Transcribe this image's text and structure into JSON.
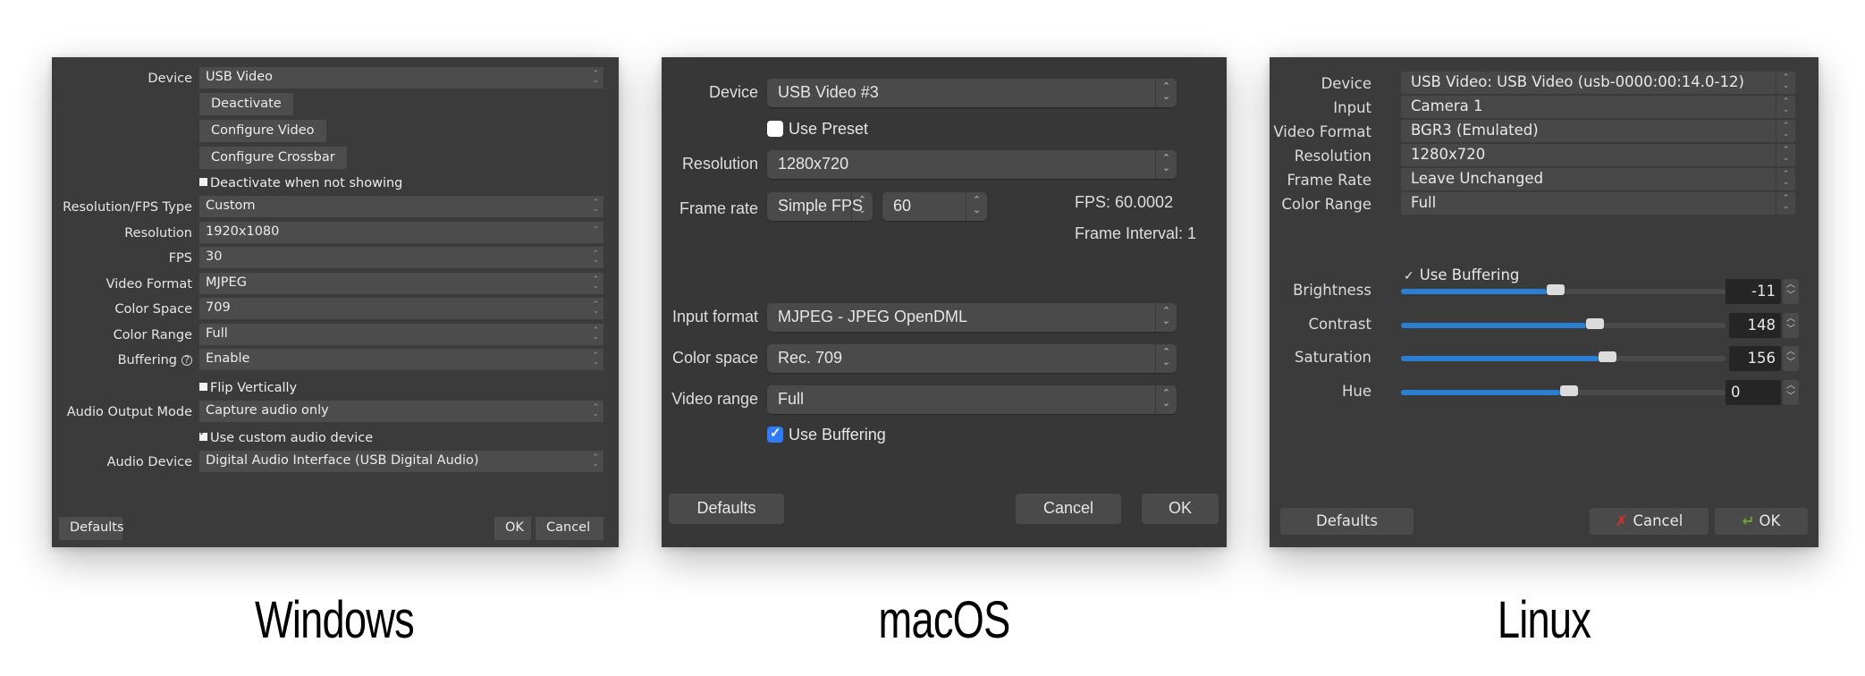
{
  "labels": {
    "windows": "Windows",
    "macos": "macOS",
    "linux": "Linux"
  },
  "windows": {
    "device_label": "Device",
    "device_value": "USB Video",
    "buttons": [
      "Deactivate",
      "Configure Video",
      "Configure Crossbar"
    ],
    "deactivate_when_not_showing": {
      "label": "Deactivate when not showing",
      "checked": false
    },
    "fields": [
      {
        "label": "Resolution/FPS Type",
        "value": "Custom",
        "arrow": "updown"
      },
      {
        "label": "Resolution",
        "value": "1920x1080",
        "arrow": "down"
      },
      {
        "label": "FPS",
        "value": "30",
        "arrow": "updown"
      },
      {
        "label": "Video Format",
        "value": "MJPEG",
        "arrow": "updown"
      },
      {
        "label": "Color Space",
        "value": "709",
        "arrow": "updown"
      },
      {
        "label": "Color Range",
        "value": "Full",
        "arrow": "updown"
      },
      {
        "label": "Buffering",
        "value": "Enable",
        "arrow": "updown",
        "help_icon": "?"
      }
    ],
    "flip_vertically": {
      "label": "Flip Vertically",
      "checked": false
    },
    "audio_output_mode": {
      "label": "Audio Output Mode",
      "value": "Capture audio only"
    },
    "use_custom_audio": {
      "label": "Use custom audio device",
      "checked": true
    },
    "audio_device": {
      "label": "Audio Device",
      "value": "Digital Audio Interface (USB Digital Audio)"
    },
    "footer": {
      "defaults": "Defaults",
      "ok": "OK",
      "cancel": "Cancel"
    },
    "arrow_updown": "⌃⌄",
    "arrow_down": "⌄"
  },
  "macos": {
    "device": {
      "label": "Device",
      "value": "USB Video #3"
    },
    "use_preset": {
      "label": "Use Preset",
      "checked": false
    },
    "resolution": {
      "label": "Resolution",
      "value": "1280x720"
    },
    "frame_rate": {
      "label": "Frame rate",
      "mode": "Simple FPS",
      "value": "60",
      "fps_info": "FPS: 60.0002",
      "interval_info": "Frame Interval: 1"
    },
    "input_format": {
      "label": "Input format",
      "value": "MJPEG - JPEG OpenDML"
    },
    "color_space": {
      "label": "Color space",
      "value": "Rec. 709"
    },
    "video_range": {
      "label": "Video range",
      "value": "Full"
    },
    "use_buffering": {
      "label": "Use Buffering",
      "checked": true
    },
    "footer": {
      "defaults": "Defaults",
      "cancel": "Cancel",
      "ok": "OK"
    },
    "stepper_glyph": "⌃\n⌄",
    "accent": "#2f7cf6"
  },
  "linux": {
    "fields": [
      {
        "label": "Device",
        "value": "USB Video: USB Video (usb-0000:00:14.0-12)"
      },
      {
        "label": "Input",
        "value": "Camera 1"
      },
      {
        "label": "Video Format",
        "value": "BGR3 (Emulated)"
      },
      {
        "label": "Resolution",
        "value": "1280x720"
      },
      {
        "label": "Frame Rate",
        "value": "Leave Unchanged"
      },
      {
        "label": "Color Range",
        "value": "Full"
      }
    ],
    "use_buffering": {
      "label": "Use Buffering",
      "checked": true,
      "check_glyph": "✓"
    },
    "sliders": [
      {
        "label": "Brightness",
        "value": "-11",
        "fraction": 0.45
      },
      {
        "label": "Contrast",
        "value": "148",
        "fraction": 0.57
      },
      {
        "label": "Saturation",
        "value": "156",
        "fraction": 0.61
      },
      {
        "label": "Hue",
        "value": "0",
        "fraction": 0.49
      }
    ],
    "footer": {
      "defaults": "Defaults",
      "cancel": "Cancel",
      "ok": "OK",
      "cancel_icon": "✗",
      "ok_icon": "↵"
    },
    "accent": "#2a7fd4"
  }
}
